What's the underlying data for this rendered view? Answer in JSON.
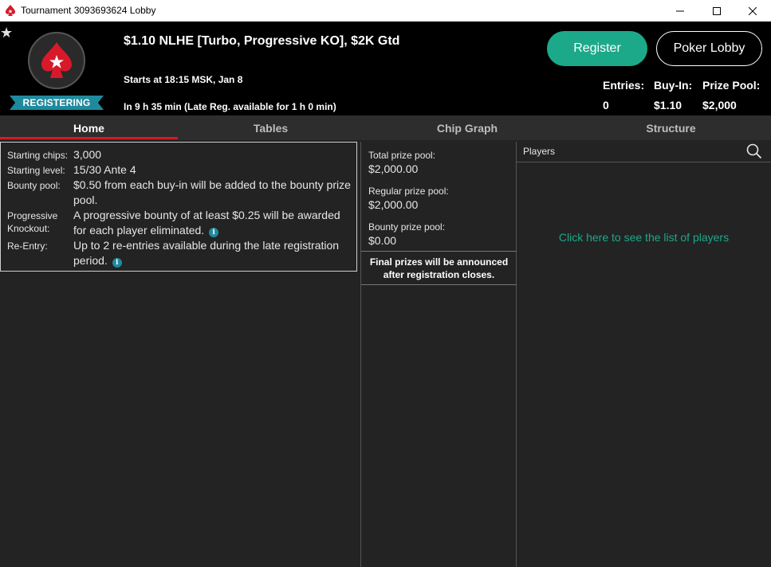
{
  "window": {
    "title": "Tournament 3093693624 Lobby"
  },
  "header": {
    "status_badge": "REGISTERING",
    "tournament_name": "$1.10 NLHE [Turbo, Progressive KO], $2K Gtd",
    "start_time": "Starts at 18:15 MSK, Jan 8",
    "countdown": "In 9 h 35 min (Late Reg. available for 1 h 0 min)",
    "register_label": "Register",
    "poker_lobby_label": "Poker Lobby",
    "stats": {
      "entries_label": "Entries:",
      "entries_value": "0",
      "buyin_label": "Buy-In:",
      "buyin_value": "$1.10",
      "prize_pool_label": "Prize Pool:",
      "prize_pool_value": "$2,000"
    }
  },
  "tabs": [
    {
      "label": "Home",
      "active": true
    },
    {
      "label": "Tables",
      "active": false
    },
    {
      "label": "Chip Graph",
      "active": false
    },
    {
      "label": "Structure",
      "active": false
    }
  ],
  "info": {
    "starting_chips_label": "Starting chips:",
    "starting_chips_value": "3,000",
    "starting_level_label": "Starting level:",
    "starting_level_value": "15/30 Ante 4",
    "bounty_pool_label": "Bounty pool:",
    "bounty_pool_value": "$0.50 from each buy-in will be added to the bounty prize pool.",
    "pko_label": "Progressive Knockout:",
    "pko_value": "A progressive bounty of at least $0.25 will be awarded for each player eliminated.",
    "reentry_label": "Re-Entry:",
    "reentry_value": "Up to 2 re-entries available during the late registration period.",
    "info_icon_glyph": "i"
  },
  "prizes": {
    "total_label": "Total prize pool:",
    "total_value": "$2,000.00",
    "regular_label": "Regular prize pool:",
    "regular_value": "$2,000.00",
    "bounty_label": "Bounty prize pool:",
    "bounty_value": "$0.00",
    "note": "Final prizes will be announced after registration closes."
  },
  "players": {
    "title": "Players",
    "link_text": "Click here to see the list of players"
  },
  "colors": {
    "accent_green": "#1ca98a",
    "brand_red": "#d7192a",
    "ribbon_teal": "#1f8a9e",
    "background": "#232323"
  },
  "icons": {
    "app": "pokerstars-spade-icon",
    "favorite": "star-icon",
    "logo": "pokerstars-logo-icon",
    "info": "info-icon",
    "search": "search-icon",
    "minimize": "minimize-icon",
    "maximize": "maximize-icon",
    "close": "close-icon"
  }
}
